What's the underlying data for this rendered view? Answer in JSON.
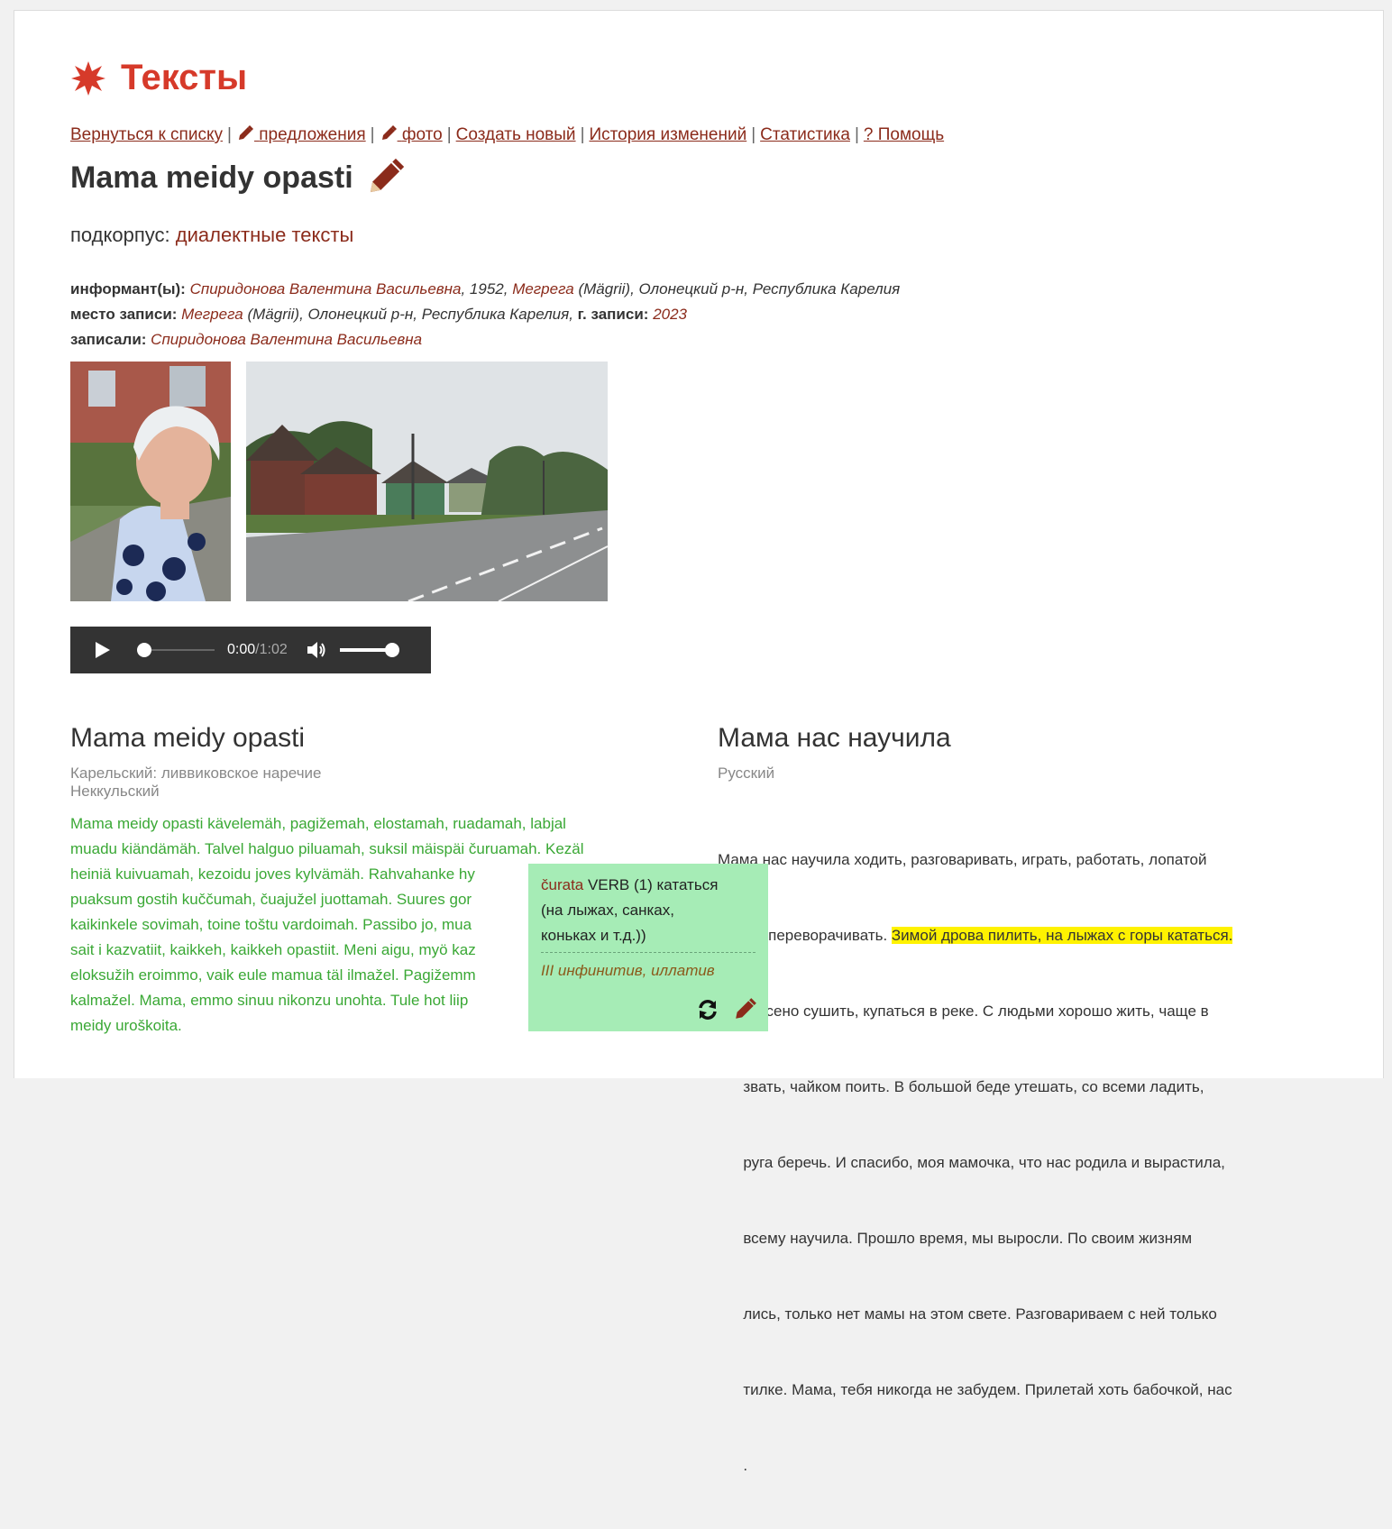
{
  "header": {
    "title": "Тексты"
  },
  "nav": {
    "back": "Вернуться к списку",
    "sentences": "предложения",
    "photo": "фото",
    "create": "Создать новый",
    "history": "История изменений",
    "stats": "Статистика",
    "help": "? Помощь",
    "separator": "|"
  },
  "text_title": "Mama meidy opasti",
  "subcorpus": {
    "label": "подкорпус:",
    "value": "диалектные тексты"
  },
  "meta": {
    "informant_label": "информант(ы):",
    "informant_name": "Спиридонова Валентина Васильевна",
    "informant_year": ", 1952, ",
    "informant_place": "Мегрега",
    "informant_place_rest": " (Mägrii), Олонецкий р-н, Республика Карелия",
    "record_place_label": "место записи:",
    "record_place": "Мегрега",
    "record_place_rest": " (Mägrii), Олонецкий р-н, Республика Карелия, ",
    "record_year_label": "г. записи:",
    "record_year": "2023",
    "recorders_label": "записали:",
    "recorders": "Спиридонова Валентина Васильевна"
  },
  "player": {
    "current": "0:00",
    "separator": " / ",
    "duration": "1:02",
    "progress": 0,
    "volume": 1.0
  },
  "left": {
    "title": "Mama meidy opasti",
    "lang1": "Карельский: ливвиковское наречие",
    "lang2": "Неккульский",
    "lines": [
      "Mama meidy opasti kävelemäh, pagižemah, elostamah, ruadamah, labjal",
      "muadu kiändämäh. Talvel halguo piluamah, suksil mäispäi čuruamah. Kezäl",
      "heiniä kuivuamah, kezoidu joves kylvämäh. Rahvahanke hy",
      "puaksum gostih kuččumah, čuajužel juottamah. Suures gor",
      "kaikinkele sovimah, toine toštu vardoimah. Passibo jo, mua",
      "sait i kazvatiit, kaikkeh, kaikkeh opastiit. Meni aigu, myö kaz",
      "eloksužih eroimmo, vaik eule mamua täl ilmažel. Pagižemm",
      "kalmažel. Mama, emmo sinuu nikonzu unohta. Tule hot liip",
      "meidy uroškoita."
    ]
  },
  "right": {
    "title": "Мама нас научила",
    "lang": "Русский",
    "line1": "Мама нас научила ходить, разговаривать, играть, работать, лопатой",
    "line2_pre": "землю переворачивать. ",
    "line2_hl": "Зимой дрова пилить, на лыжах с горы кататься.",
    "lines": [
      "Летом сено сушить, купаться в реке. С людьми хорошо жить, чаще в",
      "      звать, чайком поить. В большой беде утешать, со всеми ладить,",
      "      руга беречь. И спасибо, моя мамочка, что нас родила и вырастила,",
      "      всему научила. Прошло время, мы выросли. По своим жизням",
      "      лись, только нет мамы на этом свете. Разговариваем с ней только",
      "      тилке. Мама, тебя никогда не забудем. Прилетай хоть бабочкой, нас",
      "      ."
    ]
  },
  "tooltip": {
    "lemma": "čurata",
    "pos": " VERB (1) кататься",
    "gloss2": "(на лыжах, санках,",
    "gloss3": "коньках и т.д.))",
    "gram": "III инфинитив, иллатив"
  },
  "colors": {
    "brand": "#d63a2a",
    "link": "#8b2b1b",
    "karelian": "#3aa835",
    "highlight": "#fff200",
    "tooltip": "#a6ecb6"
  }
}
